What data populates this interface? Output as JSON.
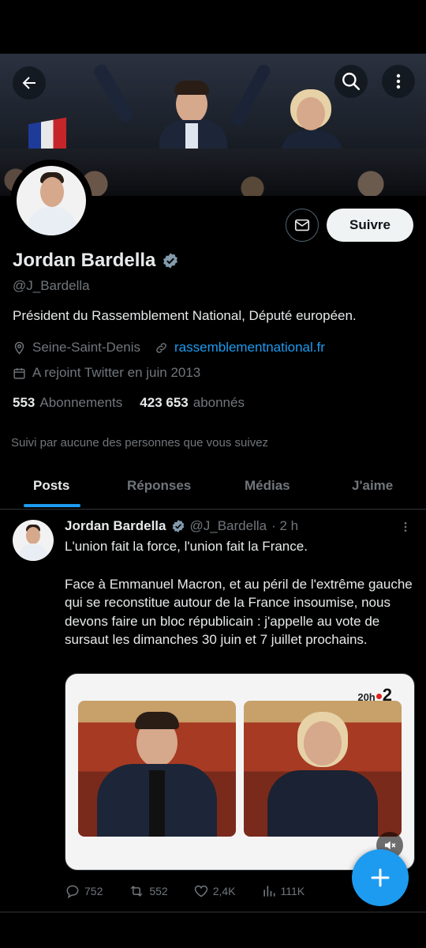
{
  "profile": {
    "name": "Jordan Bardella",
    "handle": "@J_Bardella",
    "bio": "Président du Rassemblement National, Député européen.",
    "location": "Seine-Saint-Denis",
    "website": "rassemblementnational.fr",
    "joined": "A rejoint Twitter en juin 2013",
    "following_count": "553",
    "following_label": "Abonnements",
    "followers_count": "423 653",
    "followers_label": "abonnés",
    "followed_by": "Suivi par aucune des personnes que vous suivez",
    "follow_label": "Suivre"
  },
  "tabs": [
    {
      "label": "Posts",
      "active": true
    },
    {
      "label": "Réponses",
      "active": false
    },
    {
      "label": "Médias",
      "active": false
    },
    {
      "label": "J'aime",
      "active": false
    }
  ],
  "tweet": {
    "name": "Jordan Bardella",
    "handle": "@J_Bardella",
    "time": "· 2 h",
    "text_line1": "L'union fait la force, l'union fait la France.",
    "text_body": "Face à Emmanuel Macron, et au péril de l'extrême gauche qui se reconstitue autour de la France insoumise, nous devons faire un bloc républicain : j'appelle au vote de sursaut les dimanches 30 juin et 7 juillet prochains.",
    "media_logo_left": "20h",
    "media_logo_right": "2",
    "replies": "752",
    "reposts": "552",
    "likes": "2,4K",
    "views": "111K"
  },
  "colors": {
    "accent": "#1d9bf0",
    "background": "#000000",
    "text": "#e7e9ea",
    "muted": "#71767b",
    "verified": "#829aab"
  },
  "icons": [
    "back-arrow-icon",
    "search-icon",
    "more-vertical-icon",
    "mail-icon",
    "verified-badge-icon",
    "location-pin-icon",
    "link-icon",
    "calendar-icon",
    "reply-icon",
    "repost-icon",
    "like-icon",
    "views-icon",
    "share-icon",
    "mute-icon",
    "compose-plus-icon"
  ]
}
